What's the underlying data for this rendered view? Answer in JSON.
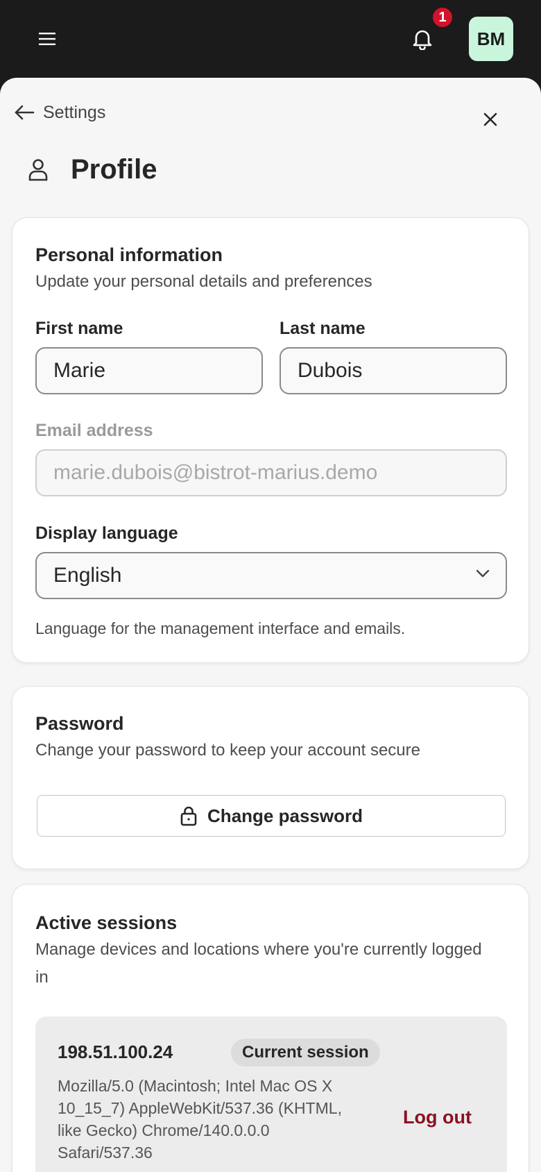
{
  "topbar": {
    "notification_count": "1",
    "avatar_initials": "BM"
  },
  "nav": {
    "back_label": "Settings"
  },
  "page": {
    "title": "Profile"
  },
  "personal_info": {
    "title": "Personal information",
    "description": "Update your personal details and preferences",
    "first_name_label": "First name",
    "first_name_value": "Marie",
    "last_name_label": "Last name",
    "last_name_value": "Dubois",
    "email_label": "Email address",
    "email_value": "marie.dubois@bistrot-marius.demo",
    "language_label": "Display language",
    "language_value": "English",
    "language_helper": "Language for the management interface and emails."
  },
  "password": {
    "title": "Password",
    "description": "Change your password to keep your account secure",
    "button_label": "Change password"
  },
  "sessions": {
    "title": "Active sessions",
    "description": "Manage devices and locations where you're currently logged in",
    "items": [
      {
        "ip": "198.51.100.24",
        "badge": "Current session",
        "user_agent": "Mozilla/5.0 (Macintosh; Intel Mac OS X 10_15_7) AppleWebKit/537.36 (KHTML, like Gecko) Chrome/140.0.0.0 Safari/537.36",
        "action_label": "Log out"
      }
    ]
  },
  "colors": {
    "topbar_bg": "#1b1b1b",
    "badge_red": "#d3122b",
    "avatar_bg": "#c9f5dc",
    "logout_red": "#8b1024"
  }
}
